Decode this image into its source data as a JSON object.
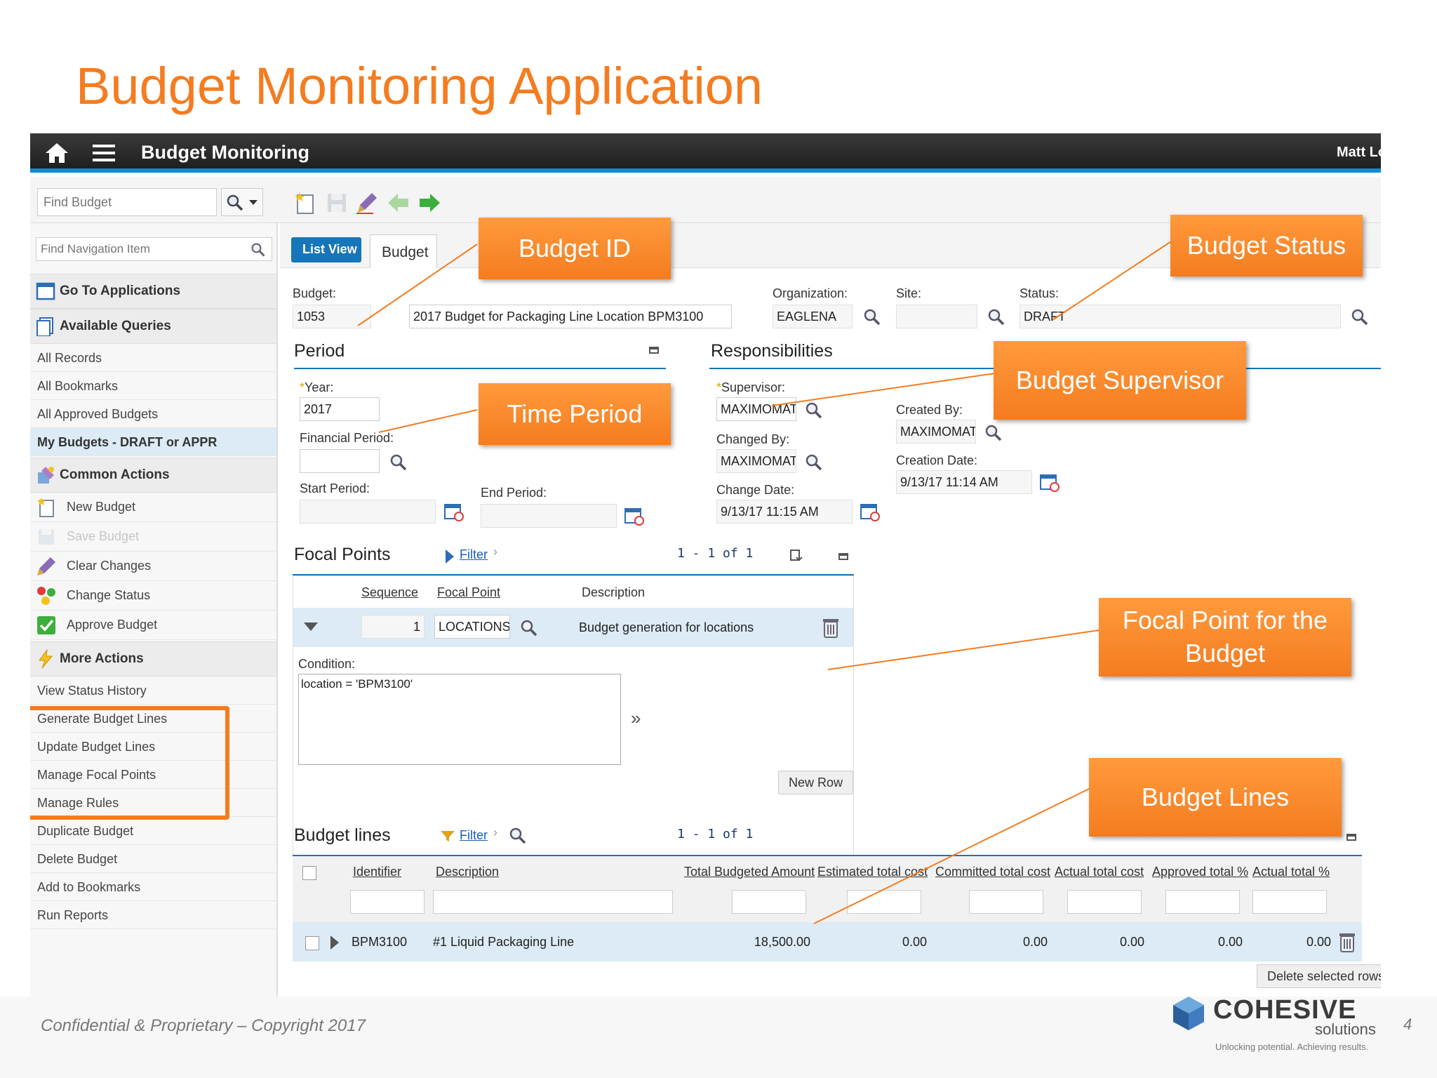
{
  "slide": {
    "title": "Budget Monitoring Application",
    "footer": "Confidential & Proprietary – Copyright 2017",
    "page_number": "4",
    "logo": {
      "name": "COHESIVE",
      "sub": "solutions",
      "tagline": "Unlocking potential. Achieving results."
    }
  },
  "app": {
    "title": "Budget Monitoring",
    "user": "Matt Lo",
    "search_placeholder": "Find Budget",
    "nav_search_placeholder": "Find Navigation Item"
  },
  "nav": {
    "goto": "Go To Applications",
    "queries_header": "Available Queries",
    "queries": [
      "All Records",
      "All Bookmarks",
      "All Approved Budgets",
      "My Budgets - DRAFT or APPR"
    ],
    "common_header": "Common Actions",
    "common": [
      "New Budget",
      "Save Budget",
      "Clear Changes",
      "Change Status",
      "Approve Budget"
    ],
    "more_header": "More Actions",
    "more": [
      "View Status History",
      "Generate Budget Lines",
      "Update Budget Lines",
      "Manage Focal Points",
      "Manage Rules",
      "Duplicate Budget",
      "Delete Budget",
      "Add to Bookmarks",
      "Run Reports"
    ]
  },
  "tabs": {
    "list_view": "List View",
    "budget": "Budget"
  },
  "header": {
    "budget_label": "Budget:",
    "budget_id": "1053",
    "budget_description": "2017 Budget for Packaging Line Location BPM3100",
    "org_label": "Organization:",
    "org_value": "EAGLENA",
    "site_label": "Site:",
    "site_value": "",
    "status_label": "Status:",
    "status_value": "DRAFT"
  },
  "period": {
    "title": "Period",
    "year_label": "Year:",
    "year_value": "2017",
    "fin_label": "Financial Period:",
    "fin_value": "",
    "start_label": "Start Period:",
    "start_value": "",
    "end_label": "End Period:",
    "end_value": ""
  },
  "resp": {
    "title": "Responsibilities",
    "supervisor_label": "Supervisor:",
    "supervisor_value": "MAXIMOMATT",
    "changed_by_label": "Changed By:",
    "changed_by_value": "MAXIMOMATT",
    "change_date_label": "Change Date:",
    "change_date_value": "9/13/17 11:15 AM",
    "created_by_label": "Created By:",
    "created_by_value": "MAXIMOMATT",
    "creation_date_label": "Creation Date:",
    "creation_date_value": "9/13/17 11:14 AM"
  },
  "focal": {
    "title": "Focal Points",
    "filter": "Filter",
    "pager": "1 - 1 of 1",
    "cols": [
      "Sequence",
      "Focal Point",
      "Description"
    ],
    "row": {
      "sequence": "1",
      "focal_point": "LOCATIONS",
      "description": "Budget generation for locations"
    },
    "condition_label": "Condition:",
    "condition_value": "location = 'BPM3100'",
    "new_row": "New Row"
  },
  "lines": {
    "title": "Budget lines",
    "filter": "Filter",
    "pager": "1 - 1 of 1",
    "cols": [
      "Identifier",
      "Description",
      "Total Budgeted Amount",
      "Estimated total cost",
      "Committed total cost",
      "Actual total cost",
      "Approved total %",
      "Actual total %"
    ],
    "row": {
      "identifier": "BPM3100",
      "description": "#1 Liquid Packaging Line",
      "total_budgeted": "18,500.00",
      "estimated": "0.00",
      "committed": "0.00",
      "actual": "0.00",
      "approved_pct": "0.00",
      "actual_pct": "0.00"
    },
    "delete_selected": "Delete selected rows"
  },
  "callouts": {
    "budget_id": "Budget ID",
    "budget_status": "Budget Status",
    "time_period": "Time Period",
    "budget_supervisor": "Budget Supervisor",
    "focal_point": "Focal Point for the Budget",
    "budget_lines": "Budget Lines"
  },
  "colors": {
    "accent_orange": "#f47c20",
    "ibm_blue": "#1775b9",
    "topbar": "#2a2a2a"
  }
}
